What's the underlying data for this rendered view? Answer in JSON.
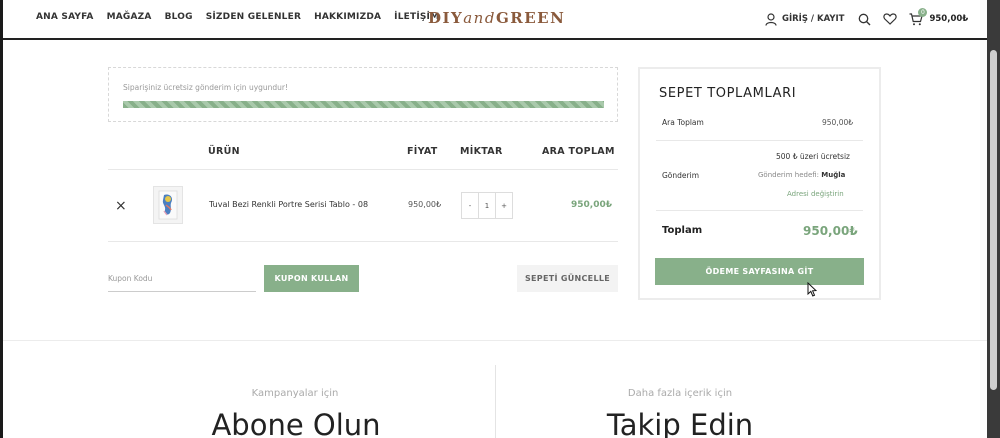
{
  "nav": {
    "items": [
      "ANA SAYFA",
      "MAĞAZA",
      "BLOG",
      "SİZDEN GELENLER",
      "HAKKIMIZDA",
      "İLETİŞİM"
    ]
  },
  "logo": {
    "part1": "DIY",
    "part2": "and",
    "part3": "GREEN"
  },
  "header": {
    "login_label": "GİRİŞ / KAYIT",
    "cart_count": "0",
    "cart_total": "950,00₺",
    "icons": [
      "user-icon",
      "search-icon",
      "heart-icon",
      "cart-icon"
    ]
  },
  "notice": {
    "text": "Siparişiniz ücretsiz gönderim için uygundur!",
    "progress_percent": 100
  },
  "cart_table": {
    "headers": {
      "product": "ÜRÜN",
      "price": "FİYAT",
      "quantity": "MİKTAR",
      "subtotal": "ARA TOPLAM"
    },
    "rows": [
      {
        "remove": "×",
        "name": "Tuval Bezi Renkli Portre Serisi Tablo - 08",
        "price": "950,00₺",
        "qty_minus": "-",
        "qty": "1",
        "qty_plus": "+",
        "subtotal": "950,00₺"
      }
    ]
  },
  "coupon": {
    "placeholder": "Kupon Kodu",
    "apply_label": "KUPON KULLAN",
    "update_label": "SEPETİ GÜNCELLE"
  },
  "totals": {
    "title": "SEPET TOPLAMLARI",
    "subtotal_label": "Ara Toplam",
    "subtotal_value": "950,00₺",
    "shipping_label": "Gönderim",
    "shipping_method": "500 ₺ üzeri ücretsiz",
    "shipping_dest_prefix": "Gönderim hedefi:",
    "shipping_dest": "Muğla",
    "shipping_change": "Adresi değiştirin",
    "total_label": "Toplam",
    "total_value": "950,00₺",
    "checkout_label": "ÖDEME SAYFASINA GİT"
  },
  "footer": {
    "left_small": "Kampanyalar için",
    "left_big": "Abone Olun",
    "right_small": "Daha fazla içerik için",
    "right_big": "Takip Edin"
  },
  "colors": {
    "accent": "#88b08a",
    "accent_text": "#7aa57c",
    "logo": "#8a5a3c"
  }
}
